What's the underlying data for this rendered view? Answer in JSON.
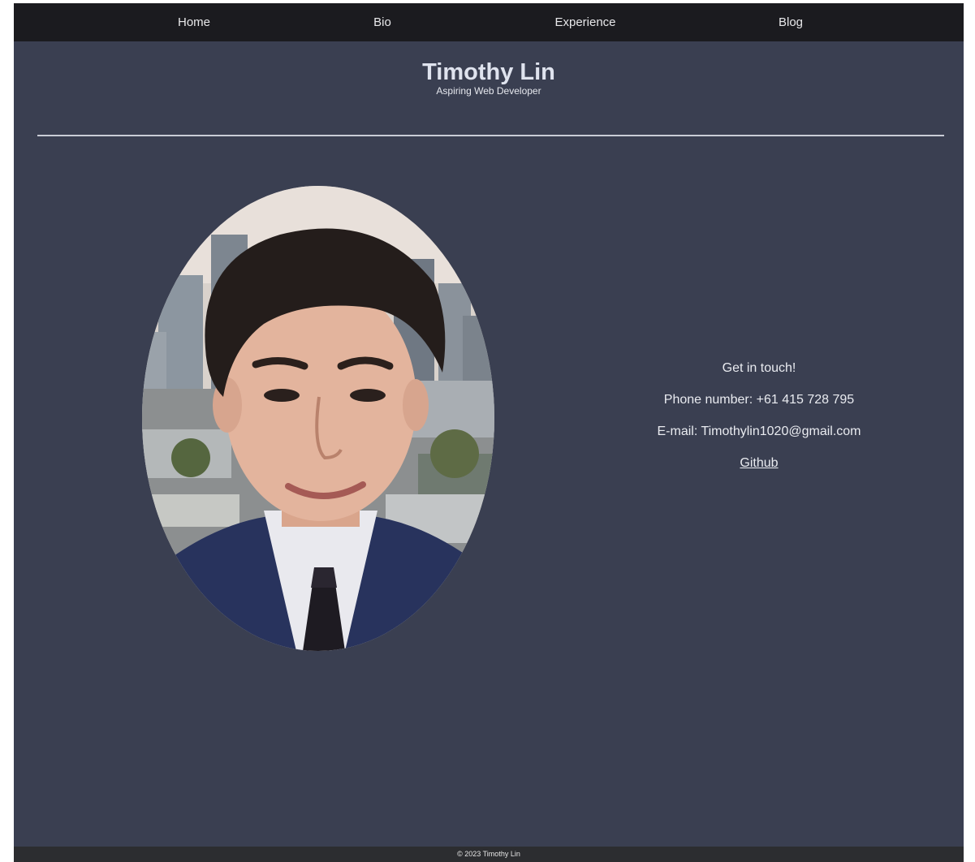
{
  "nav": {
    "items": [
      {
        "label": "Home"
      },
      {
        "label": "Bio"
      },
      {
        "label": "Experience"
      },
      {
        "label": "Blog"
      }
    ]
  },
  "header": {
    "title": "Timothy Lin",
    "subtitle": "Aspiring Web Developer"
  },
  "contact": {
    "heading": "Get in touch!",
    "phone": "Phone number: +61 415 728 795",
    "email": "E-mail: Timothylin1020@gmail.com",
    "github_label": "Github"
  },
  "footer": {
    "copyright": "© 2023 Timothy Lin"
  },
  "colors": {
    "page_bg": "#3a3f51",
    "navbar_bg": "#1b1b1f",
    "footer_bg": "#2c2d30",
    "text": "#e9ebf0"
  }
}
